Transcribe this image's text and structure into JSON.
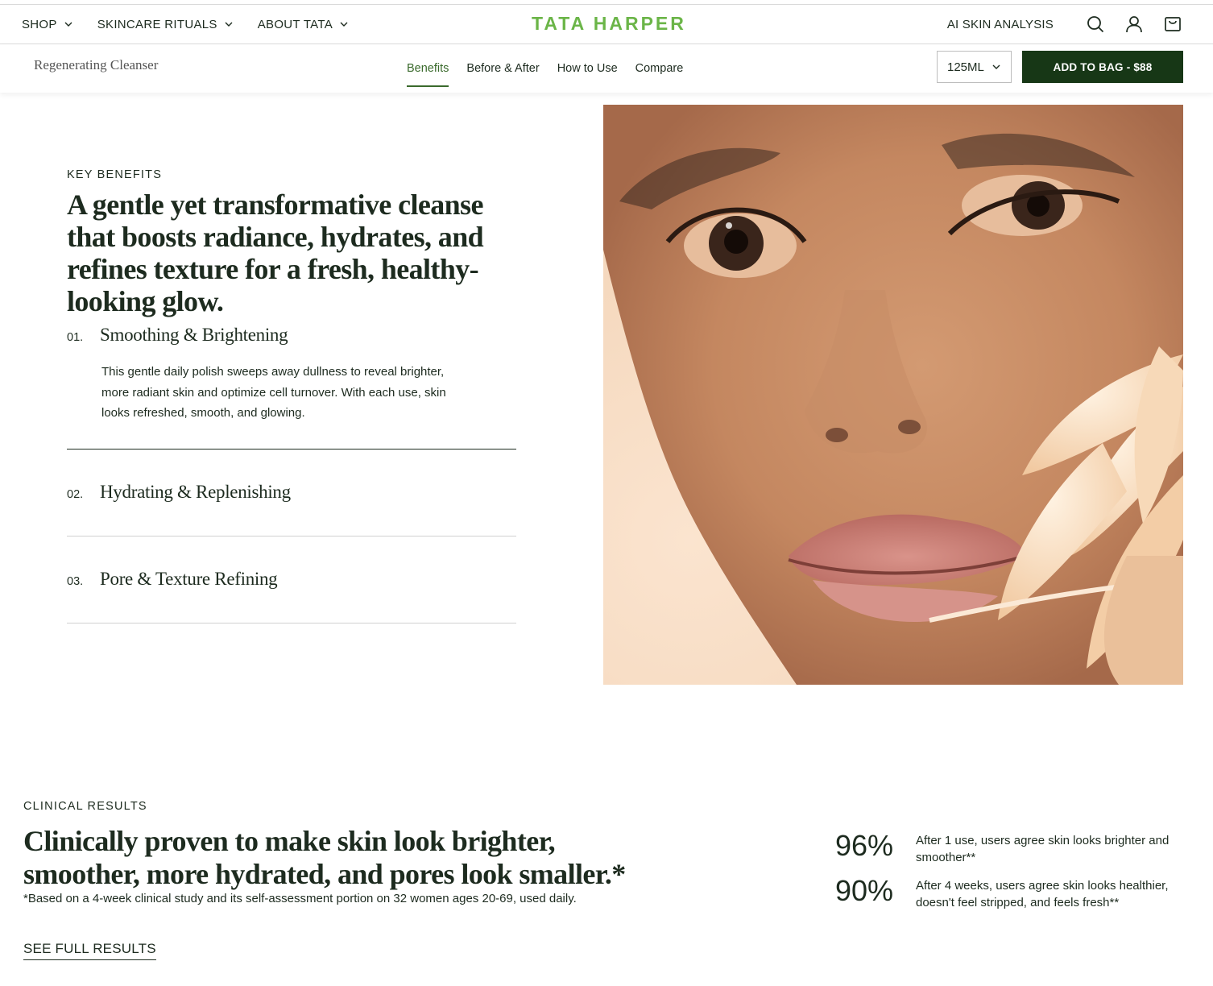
{
  "header": {
    "nav": [
      {
        "label": "SHOP"
      },
      {
        "label": "SKINCARE RITUALS"
      },
      {
        "label": "ABOUT TATA"
      }
    ],
    "brand": "TATA HARPER",
    "ai_link": "AI SKIN ANALYSIS",
    "icons": [
      "search-icon",
      "account-icon",
      "bag-icon"
    ]
  },
  "subnav": {
    "product_name": "Regenerating Cleanser",
    "tabs": [
      {
        "label": "Benefits",
        "active": true
      },
      {
        "label": "Before & After"
      },
      {
        "label": "How to Use"
      },
      {
        "label": "Compare"
      }
    ],
    "size_selected": "125ML",
    "add_to_bag": "ADD TO BAG - $88"
  },
  "benefits": {
    "kicker": "KEY BENEFITS",
    "headline": "A gentle yet transformative cleanse that boosts radiance, hydrates, and refines texture for a fresh, healthy-looking glow.",
    "items": [
      {
        "num": "01.",
        "title": "Smoothing & Brightening",
        "body": "This gentle daily polish sweeps away dullness to reveal brighter, more radiant skin and optimize cell turnover. With each use, skin looks refreshed, smooth, and glowing.",
        "expanded": true
      },
      {
        "num": "02.",
        "title": "Hydrating & Replenishing",
        "expanded": false
      },
      {
        "num": "03.",
        "title": "Pore & Texture Refining",
        "expanded": false
      }
    ]
  },
  "clinical": {
    "kicker": "CLINICAL RESULTS",
    "headline": "Clinically proven to make skin look brighter, smoother, more hydrated, and pores look smaller.*",
    "note": "*Based on a 4-week clinical study and its self-assessment portion on 32 women ages 20-69, used daily.",
    "link": "SEE FULL RESULTS",
    "stats": [
      {
        "value": "96%",
        "text": "After 1 use, users agree skin looks brighter and smoother**"
      },
      {
        "value": "90%",
        "text": "After 4 weeks, users agree skin looks healthier, doesn't feel stripped, and feels fresh**"
      }
    ]
  },
  "colors": {
    "brand_green": "#6bb548",
    "dark_green": "#173716",
    "active_tab": "#3a6a2c",
    "text": "#1d2b1f"
  }
}
